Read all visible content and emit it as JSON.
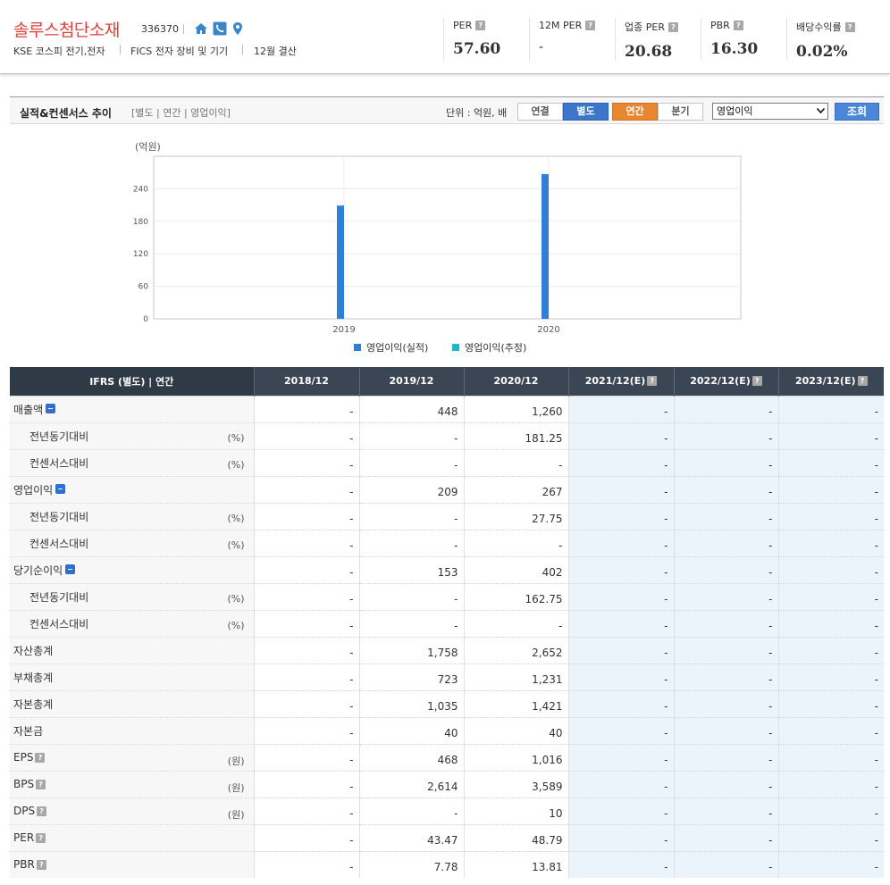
{
  "header": {
    "company_name": "솔루스첨단소재",
    "code": "336370",
    "icons": [
      "home-icon",
      "phone-icon",
      "location-icon"
    ],
    "market": "KSE  코스피 전기,전자",
    "fics": "FICS 전자 장비 및 기기",
    "fiscal": "12월 결산",
    "metrics": [
      {
        "label": "PER",
        "value": "57.60"
      },
      {
        "label": "12M PER",
        "value": "-"
      },
      {
        "label": "업종 PER",
        "value": "20.68"
      },
      {
        "label": "PBR",
        "value": "16.30"
      },
      {
        "label": "배당수익률",
        "value": "0.02%"
      }
    ],
    "help_mark": "?"
  },
  "section": {
    "title": "실적&컨센서스 추이",
    "subtitle": "[별도 | 연간 | 영업이익]",
    "unit": "단위 : 억원, 배",
    "btn_consolidated": "연결",
    "btn_separate": "별도",
    "btn_annual": "연간",
    "btn_quarter": "분기",
    "select_value": "영업이익",
    "search_button": "조회"
  },
  "chart_data": {
    "type": "bar",
    "ylabel": "(억원)",
    "categories": [
      "2019",
      "2020"
    ],
    "series": [
      {
        "name": "영업이익(실적)",
        "values": [
          209,
          267
        ],
        "color": "#2f7fd8"
      },
      {
        "name": "영업이익(추정)",
        "values": [
          null,
          null
        ],
        "color": "#1fb7c9"
      }
    ],
    "yticks": [
      0,
      60,
      120,
      180,
      240
    ],
    "ylim": [
      0,
      300
    ],
    "grid": true,
    "legend": "bottom-center"
  },
  "table": {
    "header_label": "IFRS (별도) | 연간",
    "columns": [
      "2018/12",
      "2019/12",
      "2020/12",
      "2021/12(E)",
      "2022/12(E)",
      "2023/12(E)"
    ],
    "estimate_columns": [
      3,
      4,
      5
    ],
    "rows": [
      {
        "label": "매출액",
        "expand": true,
        "values": [
          "-",
          "448",
          "1,260",
          "-",
          "-",
          "-"
        ]
      },
      {
        "label": "전년동기대비",
        "sub": true,
        "unit": "(%)",
        "values": [
          "-",
          "-",
          "181.25",
          "-",
          "-",
          "-"
        ]
      },
      {
        "label": "컨센서스대비",
        "sub": true,
        "unit": "(%)",
        "values": [
          "-",
          "-",
          "-",
          "-",
          "-",
          "-"
        ]
      },
      {
        "label": "영업이익",
        "expand": true,
        "values": [
          "-",
          "209",
          "267",
          "-",
          "-",
          "-"
        ]
      },
      {
        "label": "전년동기대비",
        "sub": true,
        "unit": "(%)",
        "values": [
          "-",
          "-",
          "27.75",
          "-",
          "-",
          "-"
        ]
      },
      {
        "label": "컨센서스대비",
        "sub": true,
        "unit": "(%)",
        "values": [
          "-",
          "-",
          "-",
          "-",
          "-",
          "-"
        ]
      },
      {
        "label": "당기순이익",
        "expand": true,
        "values": [
          "-",
          "153",
          "402",
          "-",
          "-",
          "-"
        ]
      },
      {
        "label": "전년동기대비",
        "sub": true,
        "unit": "(%)",
        "values": [
          "-",
          "-",
          "162.75",
          "-",
          "-",
          "-"
        ]
      },
      {
        "label": "컨센서스대비",
        "sub": true,
        "unit": "(%)",
        "values": [
          "-",
          "-",
          "-",
          "-",
          "-",
          "-"
        ]
      },
      {
        "label": "자산총계",
        "values": [
          "-",
          "1,758",
          "2,652",
          "-",
          "-",
          "-"
        ]
      },
      {
        "label": "부채총계",
        "values": [
          "-",
          "723",
          "1,231",
          "-",
          "-",
          "-"
        ]
      },
      {
        "label": "자본총계",
        "values": [
          "-",
          "1,035",
          "1,421",
          "-",
          "-",
          "-"
        ]
      },
      {
        "label": "자본금",
        "values": [
          "-",
          "40",
          "40",
          "-",
          "-",
          "-"
        ]
      },
      {
        "label": "EPS",
        "help": true,
        "unit": "(원)",
        "values": [
          "-",
          "468",
          "1,016",
          "-",
          "-",
          "-"
        ]
      },
      {
        "label": "BPS",
        "help": true,
        "unit": "(원)",
        "values": [
          "-",
          "2,614",
          "3,589",
          "-",
          "-",
          "-"
        ]
      },
      {
        "label": "DPS",
        "help": true,
        "unit": "(원)",
        "values": [
          "-",
          "-",
          "10",
          "-",
          "-",
          "-"
        ]
      },
      {
        "label": "PER",
        "help": true,
        "values": [
          "-",
          "43.47",
          "48.79",
          "-",
          "-",
          "-"
        ]
      },
      {
        "label": "PBR",
        "help": true,
        "values": [
          "-",
          "7.78",
          "13.81",
          "-",
          "-",
          "-"
        ]
      }
    ]
  }
}
